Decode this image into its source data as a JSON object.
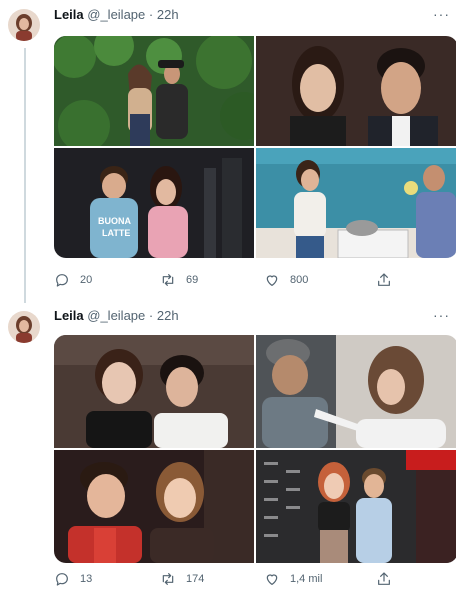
{
  "tweets": [
    {
      "author_name": "Leila",
      "author_handle": "@_leilape",
      "separator": "·",
      "time": "22h",
      "more_label": "···",
      "photos": [
        {
          "desc": "couple outdoors in front of green foliage",
          "bg": "#2f5a2a",
          "accent": "#1e3b1a"
        },
        {
          "desc": "smiling man and woman at event",
          "bg": "#3a2a26",
          "accent": "#d7b59a"
        },
        {
          "desc": "young couple on dark stage",
          "bg": "#1f1f24",
          "accent": "#7fb4cf"
        },
        {
          "desc": "woman cooking in kitchen",
          "bg": "#3c8fa6",
          "accent": "#f0ede8"
        }
      ],
      "replies": "20",
      "retweets": "69",
      "likes": "800"
    },
    {
      "author_name": "Leila",
      "author_handle": "@_leilape",
      "separator": "·",
      "time": "22h",
      "more_label": "···",
      "photos": [
        {
          "desc": "young couple close together",
          "bg": "#4a3a34",
          "accent": "#e2c8b4"
        },
        {
          "desc": "man in beanie and woman pointing",
          "bg": "#6c7378",
          "accent": "#c9b7a4"
        },
        {
          "desc": "young couple posing at night",
          "bg": "#2a1c1c",
          "accent": "#c4312b"
        },
        {
          "desc": "couple at red carpet backdrop",
          "bg": "#2b2b2d",
          "accent": "#b7cfe6"
        }
      ],
      "replies": "13",
      "retweets": "174",
      "likes": "1,4 mil"
    }
  ]
}
